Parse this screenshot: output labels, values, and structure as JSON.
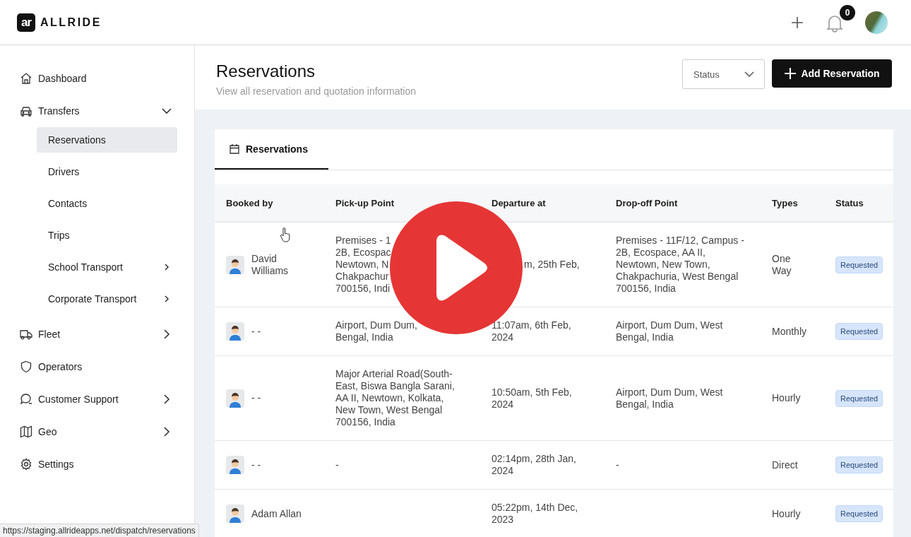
{
  "header": {
    "logo_mark": "ar",
    "logo_text": "ALLRIDE",
    "notification_count": "0"
  },
  "sidebar": {
    "items": [
      {
        "label": "Dashboard"
      },
      {
        "label": "Transfers",
        "expanded": true,
        "children": [
          {
            "label": "Reservations",
            "selected": true
          },
          {
            "label": "Drivers",
            "selected": false
          },
          {
            "label": "Contacts",
            "selected": false
          },
          {
            "label": "Trips",
            "selected": false
          },
          {
            "label": "School Transport",
            "selected": false,
            "expanded": false
          },
          {
            "label": "Corporate Transport",
            "selected": false,
            "expanded": false
          }
        ]
      },
      {
        "label": "Fleet",
        "expanded": false
      },
      {
        "label": "Operators"
      },
      {
        "label": "Customer Support",
        "expanded": false
      },
      {
        "label": "Geo",
        "expanded": false
      },
      {
        "label": "Settings"
      }
    ]
  },
  "page": {
    "title": "Reservations",
    "subtitle": "View all reservation and quotation information",
    "status_filter": {
      "placeholder": "Status"
    },
    "add_button": "Add Reservation"
  },
  "tabs": [
    {
      "label": "Reservations",
      "selected": true
    }
  ],
  "table": {
    "columns": [
      "Booked by",
      "Pick-up Point",
      "Departure at",
      "Drop-off Point",
      "Types",
      "Status"
    ],
    "rows": [
      {
        "booked_by": "David\nWilliams",
        "pickup": "Premises - 1\n2B, Ecospac\nNewtown, N\nChakpachur\n700156, Indi",
        "departure": "m, 25th Feb,",
        "dropoff": "Premises - 11F/12, Campus -\n2B, Ecospace, AA II,\nNewtown, New Town,\nChakpachuria, West Bengal\n700156, India",
        "type": "One\nWay",
        "status": "Requested"
      },
      {
        "booked_by": "- -",
        "pickup": "Airport, Dum Dum,\nBengal, India",
        "departure": "11:07am, 6th Feb,\n2024",
        "dropoff": "Airport, Dum Dum, West\nBengal, India",
        "type": "Monthly",
        "status": "Requested"
      },
      {
        "booked_by": "- -",
        "pickup": "Major Arterial Road(South-\nEast, Biswa Bangla Sarani,\nAA II, Newtown, Kolkata,\nNew Town, West Bengal\n700156, India",
        "departure": "10:50am, 5th Feb,\n2024",
        "dropoff": "Airport, Dum Dum, West\nBengal, India",
        "type": "Hourly",
        "status": "Requested"
      },
      {
        "booked_by": "- -",
        "pickup": "-",
        "departure": "02:14pm, 28th Jan,\n2024",
        "dropoff": "-",
        "type": "Direct",
        "status": "Requested"
      },
      {
        "booked_by": "Adam Allan",
        "pickup": "",
        "departure": "05:22pm, 14th Dec,\n2023",
        "dropoff": "",
        "type": "Hourly",
        "status": "Requested"
      }
    ]
  },
  "status_url": "https://staging.allrideapps.net/dispatch/reservations"
}
